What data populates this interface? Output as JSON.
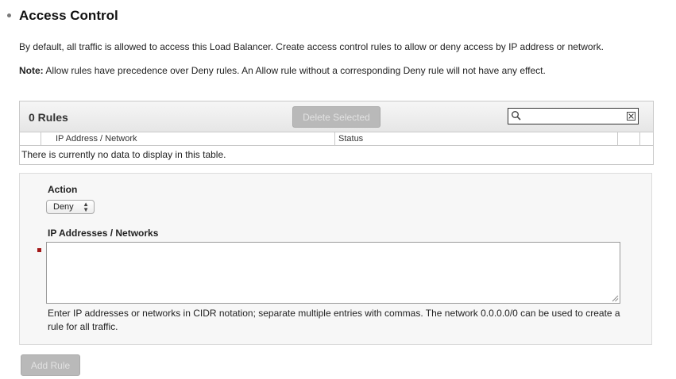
{
  "section": {
    "title": "Access Control",
    "description": "By default, all traffic is allowed to access this Load Balancer. Create access control rules to allow or deny access by IP address or network.",
    "note_label": "Note:",
    "note_text": " Allow rules have precedence over Deny rules. An Allow rule without a corresponding Deny rule will not have any effect."
  },
  "rules_table": {
    "count_label": "0 Rules",
    "delete_button": "Delete Selected",
    "search_value": "",
    "columns": [
      "IP Address / Network",
      "Status"
    ],
    "empty_message": "There is currently no data to display in this table."
  },
  "form": {
    "action_label": "Action",
    "action_value": "Deny",
    "ip_label": "IP Addresses / Networks",
    "ip_value": "",
    "help_text": "Enter IP addresses or networks in CIDR notation; separate multiple entries with commas. The network 0.0.0.0/0 can be used to create a rule for all traffic.",
    "add_button": "Add Rule"
  },
  "icons": {
    "search": "search-icon",
    "clear": "clear-icon",
    "select_arrows": "up-down-arrows-icon",
    "resize": "resize-grip-icon"
  },
  "colors": {
    "disabled_button": "#b9b9b9",
    "required_marker": "#a31818",
    "panel_background": "#f7f7f7"
  }
}
